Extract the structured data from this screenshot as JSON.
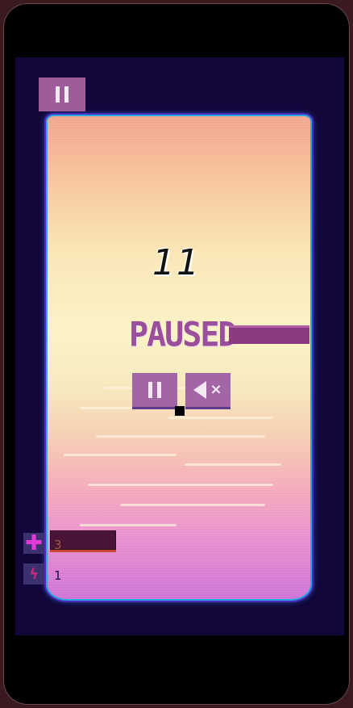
{
  "hud": {
    "pause_icon": "pause-icon",
    "score": "11",
    "health": {
      "icon": "plus-icon",
      "count": "3"
    },
    "boost": {
      "icon": "lightning-icon",
      "count": "1"
    }
  },
  "pause_menu": {
    "title": "PAUSED",
    "resume_icon": "pause-icon",
    "mute_icon": "speaker-mute-icon"
  },
  "colors": {
    "panel_purple": "#a266a6",
    "frame_blue": "#2aa8e0",
    "background_navy": "#12063a"
  }
}
